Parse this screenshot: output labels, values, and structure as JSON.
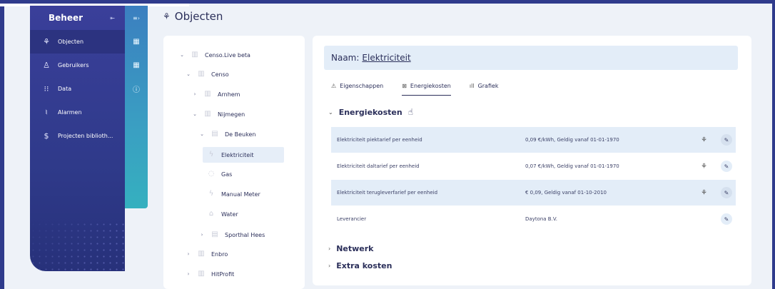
{
  "sidebar": {
    "title": "Beheer",
    "collapse_icon": "collapse-left-icon",
    "items": [
      {
        "label": "Objecten",
        "icon": "objects-icon",
        "active": true
      },
      {
        "label": "Gebruikers",
        "icon": "users-icon",
        "active": false
      },
      {
        "label": "Data",
        "icon": "data-icon",
        "active": false
      },
      {
        "label": "Alarmen",
        "icon": "alarm-icon",
        "active": false
      },
      {
        "label": "Projecten biblioth...",
        "icon": "projects-icon",
        "active": false
      }
    ]
  },
  "header": {
    "title": "Objecten"
  },
  "tree": {
    "items": [
      {
        "label": "Censo.Live beta",
        "expanded": true
      },
      {
        "label": "Censo",
        "expanded": true
      },
      {
        "label": "Arnhem",
        "expanded": false
      },
      {
        "label": "Nijmegen",
        "expanded": true
      },
      {
        "label": "De Beuken",
        "expanded": true
      },
      {
        "label": "Elektriciteit",
        "selected": true
      },
      {
        "label": "Gas"
      },
      {
        "label": "Manual Meter"
      },
      {
        "label": "Water"
      },
      {
        "label": "Sporthal Hees",
        "expanded": false
      },
      {
        "label": "Enbro",
        "expanded": false
      },
      {
        "label": "HitProfit",
        "expanded": false
      }
    ]
  },
  "main": {
    "name_label": "Naam:",
    "name_value": "Elektriciteit",
    "tabs": [
      {
        "label": "Eigenschappen",
        "icon": "properties-icon",
        "active": false
      },
      {
        "label": "Energiekosten",
        "icon": "energy-costs-icon",
        "active": true
      },
      {
        "label": "Grafiek",
        "icon": "chart-icon",
        "active": false
      }
    ],
    "sections": {
      "energiekosten": "Energiekosten",
      "netwerk": "Netwerk",
      "extra_kosten": "Extra kosten"
    },
    "cost_rows": [
      {
        "label": "Elektriciteit piektarief per eenheid",
        "value": "0,09 €/kWh, Geldig vanaf 01-01-1970"
      },
      {
        "label": "Elektriciteit daltarief per eenheid",
        "value": "0,07 €/kWh, Geldig vanaf 01-01-1970"
      },
      {
        "label": "Elektriciteit terugleverfarief per eenheid",
        "value": "€ 0,09, Geldig vanaf 01-10-2010"
      },
      {
        "label": "Leverancier",
        "value": "Daytona B.V."
      }
    ]
  },
  "colors": {
    "sidebar": "#2f3a8a",
    "sidestrip": "#3a9fc2",
    "highlight": "#e3edf8",
    "text": "#2b2f5a"
  }
}
